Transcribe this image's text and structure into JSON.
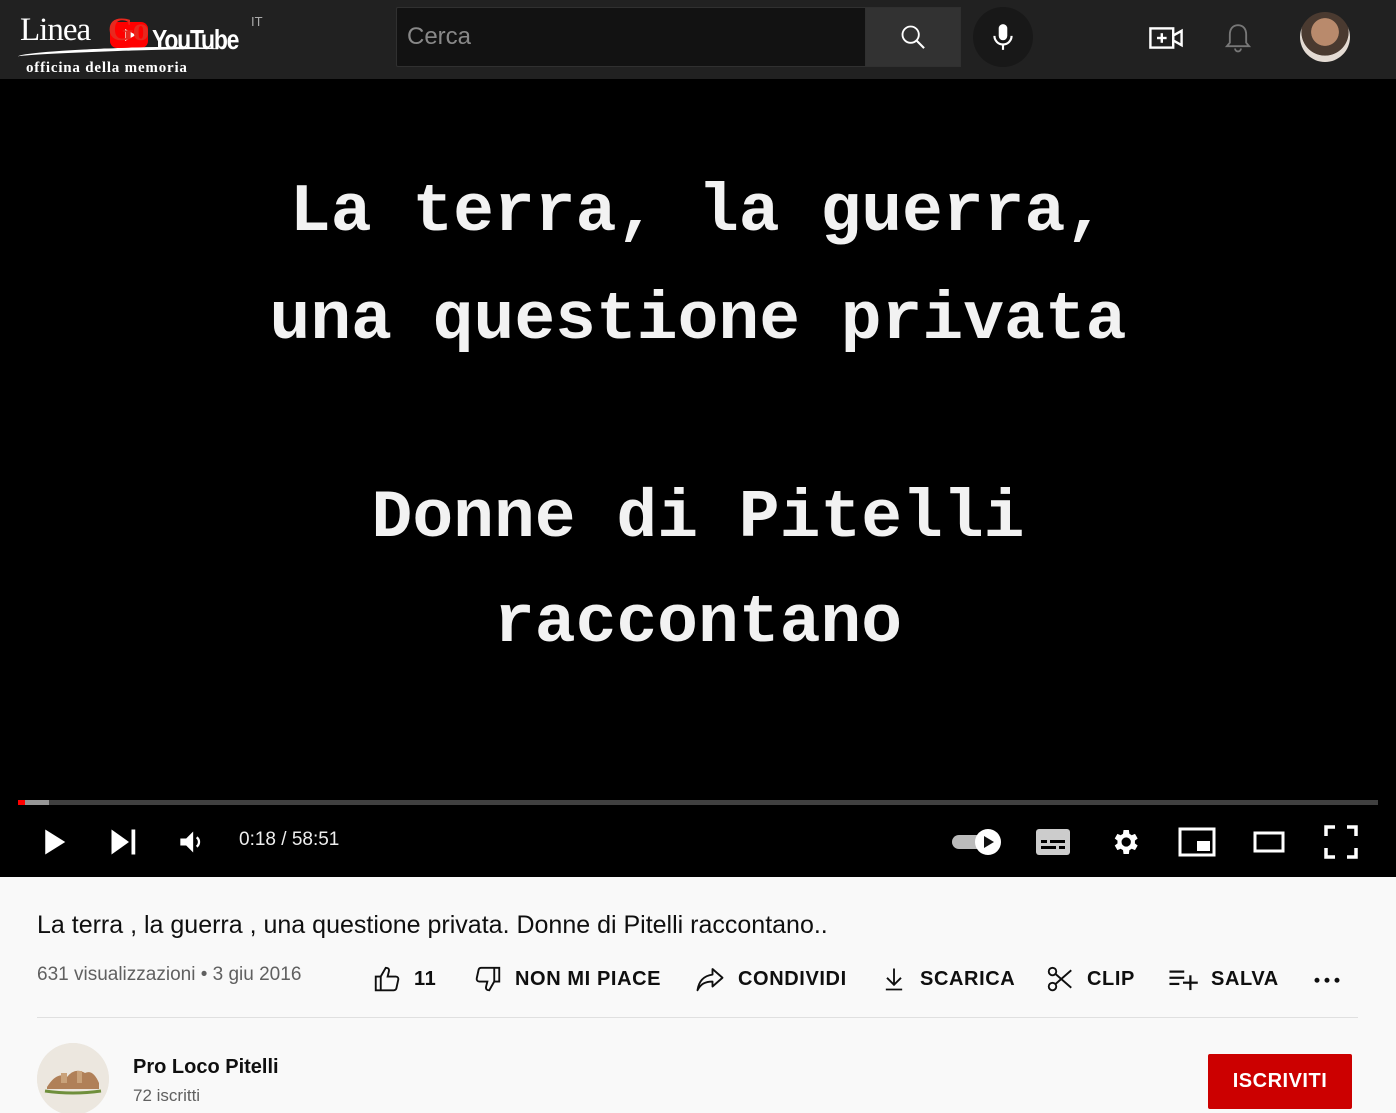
{
  "header": {
    "logo_text_1": "Linea",
    "logo_text_2": "Go",
    "logo_youtube": "YouTube",
    "logo_subtitle": "officina della memoria",
    "country_code": "IT",
    "search_placeholder": "Cerca",
    "icons": [
      "search-icon",
      "mic-icon",
      "create-video-icon",
      "notifications-bell-icon",
      "user-avatar"
    ]
  },
  "video": {
    "overlay_lines": [
      "La terra, la guerra,",
      "una questione privata",
      "Donne di Pitelli",
      "raccontano"
    ],
    "played_fraction": 0.005,
    "loaded_fraction": 0.023,
    "time_display": "0:18 / 58:51",
    "colors": {
      "progress_played": "#ff0000",
      "background": "#000000"
    }
  },
  "info": {
    "title": "La terra , la guerra , una questione privata. Donne di Pitelli raccontano..",
    "views": "631 visualizzazioni",
    "separator": "•",
    "date": "3 giu 2016",
    "actions": {
      "like_count": "11",
      "dislike": "NON MI PIACE",
      "share": "CONDIVIDI",
      "download": "SCARICA",
      "clip": "CLIP",
      "save": "SALVA"
    }
  },
  "channel": {
    "name": "Pro Loco Pitelli",
    "subscribers": "72 iscritti",
    "subscribe_label": "ISCRIVITI",
    "accent": "#cc0000"
  }
}
